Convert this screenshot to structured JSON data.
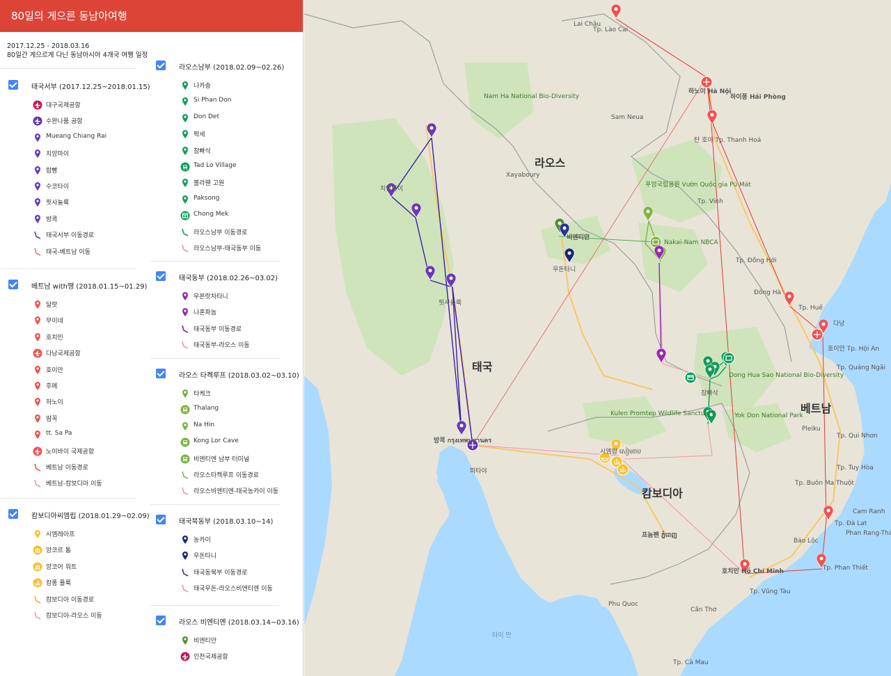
{
  "app": {
    "title": "80일의 게으른 동남아여행"
  },
  "description": {
    "dates": "2017.12.25 - 2018.03.16",
    "text": "80일간 게으르게 다닌 동남아시아 4개국 여행 일정"
  },
  "colors": {
    "accent": "#db4437",
    "checkbox": "#4285f4"
  },
  "layers": [
    {
      "title": "태국서부 (2017.12.25~2018.01.15)",
      "items": [
        {
          "label": "대구국제공항",
          "icon": "airport-icon",
          "color": "#c2185b"
        },
        {
          "label": "수완나품 공항",
          "icon": "airport-icon",
          "color": "#5e35b1"
        },
        {
          "label": "Mueang Chiang Rai",
          "icon": "pin-icon",
          "color": "#673ab7"
        },
        {
          "label": "치앙마이",
          "icon": "pin-icon",
          "color": "#673ab7"
        },
        {
          "label": "람빵",
          "icon": "pin-icon",
          "color": "#673ab7"
        },
        {
          "label": "수코타이",
          "icon": "pin-icon",
          "color": "#673ab7"
        },
        {
          "label": "핏사눌룩",
          "icon": "pin-icon",
          "color": "#673ab7"
        },
        {
          "label": "방콕",
          "icon": "pin-icon",
          "color": "#673ab7"
        },
        {
          "label": "태국서부 이동경로",
          "icon": "route-icon",
          "color": "#5e35b1"
        },
        {
          "label": "태국-베트남 이동",
          "icon": "route-icon",
          "color": "#e57373"
        }
      ]
    },
    {
      "title": "베트남 with땡 (2018.01.15~01.29)",
      "items": [
        {
          "label": "달랏",
          "icon": "pin-icon",
          "color": "#ef5350"
        },
        {
          "label": "무이네",
          "icon": "pin-icon",
          "color": "#ef5350"
        },
        {
          "label": "호치민",
          "icon": "pin-icon",
          "color": "#ef5350"
        },
        {
          "label": "다낭국제공항",
          "icon": "airport-icon",
          "color": "#ef5350"
        },
        {
          "label": "호이안",
          "icon": "pin-icon",
          "color": "#ef5350"
        },
        {
          "label": "후에",
          "icon": "pin-icon",
          "color": "#ef5350"
        },
        {
          "label": "하노이",
          "icon": "pin-icon",
          "color": "#ef5350"
        },
        {
          "label": "땀꼭",
          "icon": "pin-icon",
          "color": "#ef5350"
        },
        {
          "label": "tt. Sa Pa",
          "icon": "pin-icon",
          "color": "#ef5350"
        },
        {
          "label": "노이바이 국제공항",
          "icon": "airport-icon",
          "color": "#ef5350"
        },
        {
          "label": "베트남 이동경로",
          "icon": "route-icon",
          "color": "#ef5350"
        },
        {
          "label": "베트남-캄보디아 이동",
          "icon": "route-icon",
          "color": "#f48fb1"
        }
      ]
    },
    {
      "title": "캄보디아씨엠립 (2018.01.29~02.09)",
      "items": [
        {
          "label": "시엠레아프",
          "icon": "pin-icon",
          "color": "#fbc02d"
        },
        {
          "label": "앙코르 톰",
          "icon": "temple-icon",
          "color": "#fbc02d"
        },
        {
          "label": "앙코어 워트",
          "icon": "temple-icon",
          "color": "#fbc02d"
        },
        {
          "label": "캄퐁 플룩",
          "icon": "boat-icon",
          "color": "#fbc02d"
        },
        {
          "label": "캄보디아 이동경로",
          "icon": "route-icon",
          "color": "#f9a825"
        },
        {
          "label": "캄보디아-라오스 이동",
          "icon": "route-icon",
          "color": "#ef9a9a"
        }
      ]
    },
    {
      "title": "라오스남부 (2018.02.09~02.26)",
      "items": [
        {
          "label": "나카송",
          "icon": "pin-icon",
          "color": "#0f9d58"
        },
        {
          "label": "Si Phan Don",
          "icon": "pin-icon",
          "color": "#0f9d58"
        },
        {
          "label": "Don Det",
          "icon": "pin-icon",
          "color": "#0f9d58"
        },
        {
          "label": "팍세",
          "icon": "pin-icon",
          "color": "#0f9d58"
        },
        {
          "label": "참빠삭",
          "icon": "pin-icon",
          "color": "#0f9d58"
        },
        {
          "label": "Tad Lo Village",
          "icon": "bus-icon",
          "color": "#0f9d58"
        },
        {
          "label": "볼라웬 고원",
          "icon": "pin-icon",
          "color": "#0f9d58"
        },
        {
          "label": "Paksong",
          "icon": "pin-icon",
          "color": "#0f9d58"
        },
        {
          "label": "Chong Mek",
          "icon": "border-icon",
          "color": "#0f9d58"
        },
        {
          "label": "라오스남부 이동경로",
          "icon": "route-icon",
          "color": "#0f9d58"
        },
        {
          "label": "라오스남부-태국동부 이동",
          "icon": "route-icon",
          "color": "#f48fb1"
        }
      ]
    },
    {
      "title": "태국동부 (2018.02.26~03.02)",
      "items": [
        {
          "label": "우본랏차타니",
          "icon": "pin-icon",
          "color": "#9c27b0"
        },
        {
          "label": "나혼파놈",
          "icon": "pin-icon",
          "color": "#9c27b0"
        },
        {
          "label": "태국동부 이동경로",
          "icon": "route-icon",
          "color": "#7b1fa2"
        },
        {
          "label": "태국동부-라오스 이동",
          "icon": "route-icon",
          "color": "#f48fb1"
        }
      ]
    },
    {
      "title": "라오스 타켁루프 (2018.03.02~03.10)",
      "items": [
        {
          "label": "타케크",
          "icon": "pin-icon",
          "color": "#7cb342"
        },
        {
          "label": "Thalang",
          "icon": "bus-icon",
          "color": "#7cb342"
        },
        {
          "label": "Na Hin",
          "icon": "pin-icon",
          "color": "#7cb342"
        },
        {
          "label": "Kong Lor Cave",
          "icon": "bus-icon",
          "color": "#7cb342"
        },
        {
          "label": "비엔티엔 남부 터미널",
          "icon": "bus-icon",
          "color": "#7cb342"
        },
        {
          "label": "라오스타켁루프 이동경로",
          "icon": "route-icon",
          "color": "#7cb342"
        },
        {
          "label": "라오스비엔티엔-태국농카이 이동",
          "icon": "route-icon",
          "color": "#f48fb1"
        }
      ]
    },
    {
      "title": "태국북동부 (2018.03.10~14)",
      "items": [
        {
          "label": "농카이",
          "icon": "pin-icon",
          "color": "#1a237e"
        },
        {
          "label": "우돈타니",
          "icon": "pin-icon",
          "color": "#1a237e"
        },
        {
          "label": "태국동북부 이동경로",
          "icon": "route-icon",
          "color": "#283593"
        },
        {
          "label": "태국우돈-라오스비엔티엔 이동",
          "icon": "route-icon",
          "color": "#f48fb1"
        }
      ]
    },
    {
      "title": "라오스 비엔티엔 (2018.03.14~03.16)",
      "items": [
        {
          "label": "비엔티안",
          "icon": "pin-icon",
          "color": "#558b2f"
        },
        {
          "label": "인천국제공항",
          "icon": "airport-icon",
          "color": "#c2185b"
        }
      ]
    }
  ],
  "map": {
    "countries": [
      "라오스",
      "태국",
      "캄보디아",
      "베트남"
    ],
    "cities": [
      "하이퐁 Hải Phòng",
      "Tp. Lào Cai",
      "하노이 Hà Nội",
      "탄 호아 Tp. Thanh Hoá",
      "Tp. Vinh",
      "Tp. Đồng Hới",
      "Tp. Huế",
      "다낭",
      "호이안 Tp. Hội An",
      "Tp. Quảng Ngãi",
      "Tp. Qui Nhơn",
      "Tp. Tuy Hòa",
      "Tp. Buôn Ma Thuột",
      "Tp. Đà Lạt",
      "Cam Ranh",
      "Phan Rang-Tháp Chàm",
      "Tp. Phan Thiết",
      "호치민 Hồ Chí Minh",
      "Tp. Vũng Tàu",
      "Cần Thơ",
      "Tp. Cà Mau",
      "프놈펜 ភ្នំពេញ",
      "시엠립 សៀមរាប",
      "Phu Quoc",
      "치앙마이",
      "핏사눌룩",
      "방콕 กรุงเทพมหานคร",
      "파타야",
      "비엔티안",
      "우돈타니",
      "참빠삭",
      "Xayaboury",
      "Sam Neua",
      "Lai Châu",
      "Pleiku",
      "Đông Hà",
      "Bảo Lộc",
      "푸엉국립공원 Vườn Quốc gia Pù Mát",
      "Nakai-Nam NBCA",
      "Dong Hua Sao National Bio-Diversity",
      "Kulen Promtep Wildlife Sanctuary",
      "Nam Ha National Bio-Diversity",
      "Yok Don National Park",
      "타이 만"
    ]
  }
}
